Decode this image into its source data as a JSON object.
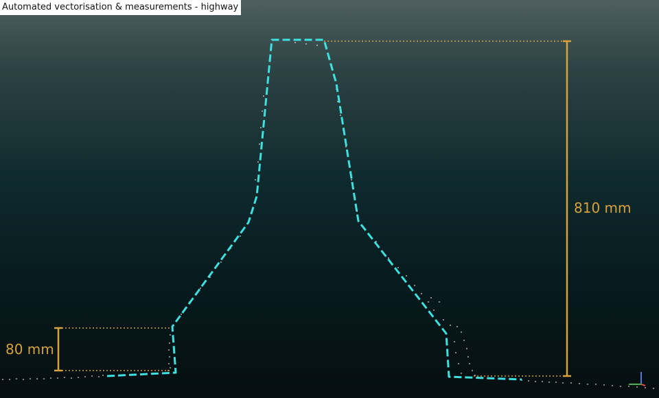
{
  "window": {
    "title": "Automated vectorisation & measurements - highway"
  },
  "measurements": {
    "height_label": "810 mm",
    "step_label": "80 mm"
  },
  "colors": {
    "profile_line": "#3ee0e0",
    "measurement": "#d8a23c",
    "point_cloud": "#ffffff",
    "background_top": "#4f5f60",
    "background_bottom": "#050e10"
  },
  "axis_gizmo": {
    "icon": "xyz-axis-icon"
  }
}
